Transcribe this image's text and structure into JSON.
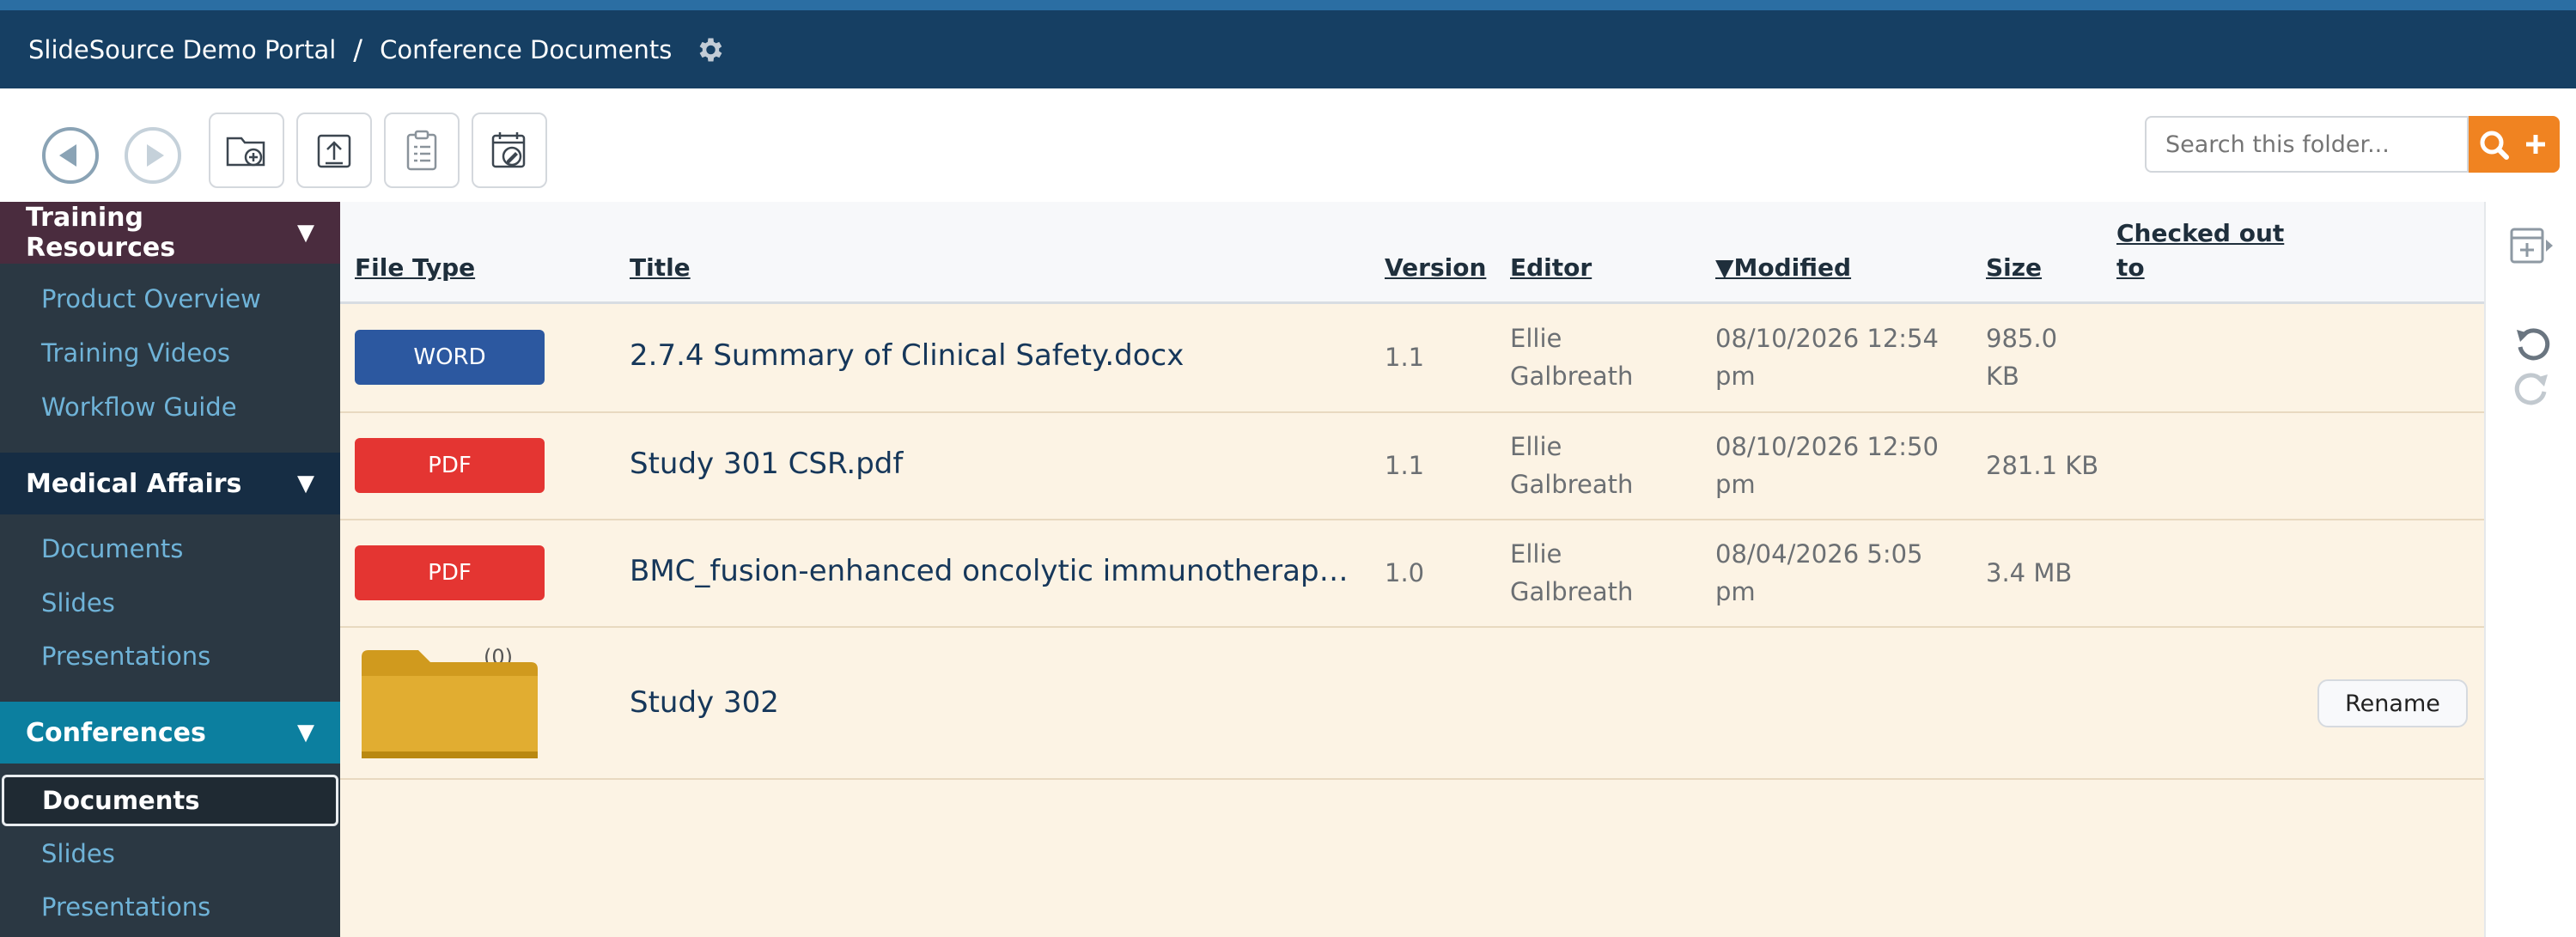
{
  "header": {
    "portal": "SlideSource Demo Portal",
    "separator": "/",
    "current": "Conference Documents"
  },
  "search": {
    "placeholder": "Search this folder..."
  },
  "sidebar": {
    "sections": [
      {
        "title": "Training Resources",
        "items": [
          "Product Overview",
          "Training Videos",
          "Workflow Guide"
        ]
      },
      {
        "title": "Medical Affairs",
        "items": [
          "Documents",
          "Slides",
          "Presentations"
        ]
      },
      {
        "title": "Conferences",
        "items": [
          "Documents",
          "Slides",
          "Presentations"
        ]
      }
    ]
  },
  "table": {
    "columns": {
      "file_type": "File Type",
      "title": "Title",
      "version": "Version",
      "editor": "Editor",
      "modified": "▼Modified",
      "size": "Size",
      "checked_out_1": "Checked out",
      "checked_out_2": "to"
    },
    "rows": [
      {
        "type": "WORD",
        "title": "2.7.4 Summary of Clinical Safety.docx",
        "version": "1.1",
        "editor_1": "Ellie",
        "editor_2": "Galbreath",
        "modified_1": "08/10/2026 12:54",
        "modified_2": "pm",
        "size_1": "985.0",
        "size_2": "KB"
      },
      {
        "type": "PDF",
        "title": "Study 301 CSR.pdf",
        "version": "1.1",
        "editor_1": "Ellie",
        "editor_2": "Galbreath",
        "modified_1": "08/10/2026 12:50",
        "modified_2": "pm",
        "size": "281.1 KB"
      },
      {
        "type": "PDF",
        "title": "BMC_fusion-enhanced oncolytic immunotherap…",
        "version": "1.0",
        "editor_1": "Ellie",
        "editor_2": "Galbreath",
        "modified_1": "08/04/2026 5:05",
        "modified_2": "pm",
        "size": "3.4 MB"
      }
    ],
    "folder": {
      "count": "(0)",
      "title": "Study 302",
      "action": "Rename"
    }
  },
  "colors": {
    "word": "#2c58a0",
    "pdf": "#e43532",
    "accent": "#f08321",
    "header": "#163f63"
  }
}
